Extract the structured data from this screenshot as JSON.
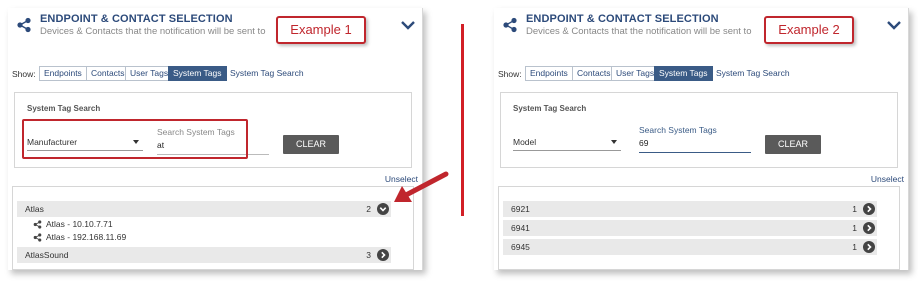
{
  "colors": {
    "brand_navy": "#2c4a7a",
    "callout_red": "#c0262d",
    "active_tab": "#3a5b86",
    "clear_button": "#5a5a5a"
  },
  "panels": [
    {
      "header": {
        "title": "ENDPOINT & CONTACT SELECTION",
        "subtitle": "Devices & Contacts that the notification will be sent to"
      },
      "callout": "Example 1",
      "show_label": "Show:",
      "tabs": [
        "Endpoints",
        "Contacts",
        "User Tags",
        "System Tags"
      ],
      "active_tab": "System Tags",
      "tab_link": "System Tag Search",
      "search": {
        "title": "System Tag Search",
        "select_value": "Manufacturer",
        "input_label": "Search System Tags",
        "input_value": "at",
        "clear_label": "CLEAR"
      },
      "unselect": "Unselect",
      "results": [
        {
          "name": "Atlas",
          "count": "2",
          "expanded": true,
          "children": [
            "Atlas - 10.10.7.71",
            "Atlas - 192.168.11.69"
          ]
        },
        {
          "name": "AtlasSound",
          "count": "3",
          "expanded": false
        }
      ]
    },
    {
      "header": {
        "title": "ENDPOINT & CONTACT SELECTION",
        "subtitle": "Devices & Contacts that the notification will be sent to"
      },
      "callout": "Example 2",
      "show_label": "Show:",
      "tabs": [
        "Endpoints",
        "Contacts",
        "User Tags",
        "System Tags"
      ],
      "active_tab": "System Tags",
      "tab_link": "System Tag Search",
      "search": {
        "title": "System Tag Search",
        "select_value": "Model",
        "input_label": "Search System Tags",
        "input_value": "69",
        "clear_label": "CLEAR"
      },
      "unselect": "Unselect",
      "results": [
        {
          "name": "6921",
          "count": "1",
          "expanded": false
        },
        {
          "name": "6941",
          "count": "1",
          "expanded": false
        },
        {
          "name": "6945",
          "count": "1",
          "expanded": false
        }
      ]
    }
  ]
}
